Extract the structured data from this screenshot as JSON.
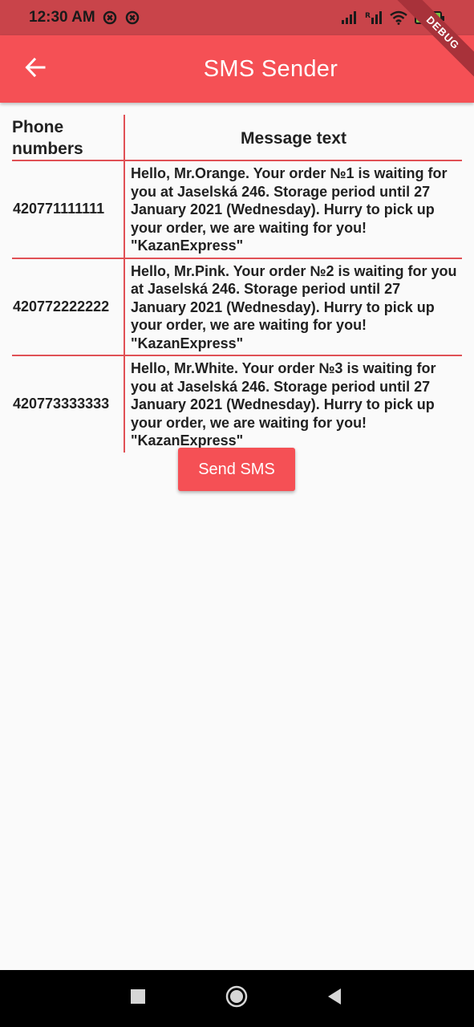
{
  "status_bar": {
    "time": "12:30 AM",
    "battery_level": "74"
  },
  "debug_banner": "DEBUG",
  "app_bar": {
    "title": "SMS Sender",
    "back_icon": "arrow-back-icon"
  },
  "table": {
    "headers": [
      "Phone numbers",
      "Message text"
    ],
    "rows": [
      {
        "phone": "420771111111",
        "message": "Hello, Mr.Orange. Your order №1 is waiting for you at Jaselská 246. Storage period until 27 January 2021 (Wednesday). Hurry to pick up your order, we are waiting for you! \"KazanExpress\""
      },
      {
        "phone": "420772222222",
        "message": "Hello, Mr.Pink. Your order №2 is waiting for you at Jaselská 246. Storage period until 27 January 2021 (Wednesday). Hurry to pick up your order, we are waiting for you! \"KazanExpress\""
      },
      {
        "phone": "420773333333",
        "message": "Hello, Mr.White. Your order №3 is waiting for you at Jaselská 246. Storage period until 27 January 2021 (Wednesday). Hurry to pick up your order, we are waiting for you! \"KazanExpress\""
      }
    ]
  },
  "send_button": {
    "label": "Send SMS"
  },
  "colors": {
    "primary": "#f55055",
    "status_bar": "#c9444a",
    "divider": "#e05055",
    "background": "#fafafa"
  },
  "nav_bar": {
    "icons": [
      "recents-square-icon",
      "home-circle-icon",
      "back-triangle-icon"
    ]
  }
}
